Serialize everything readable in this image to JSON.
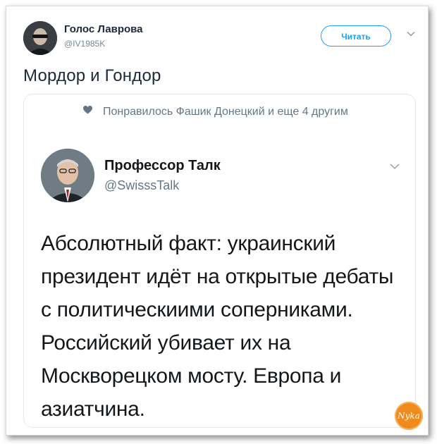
{
  "tweet": {
    "author": {
      "name": "Голос Лаврова",
      "handle": "@IV1985K"
    },
    "follow_label": "Читать",
    "text": "Мордор и Гондор"
  },
  "quoted": {
    "liked_text": "Понравилось Фашик Донецкий и еще 4 другим",
    "author": {
      "name": "Профессор Талк",
      "handle": "@SwisssTalk"
    },
    "body": "Абсолютный факт: украинский президент идёт на открытые дебаты с политическиими соперниками. Российский убивает их на Москворецком мосту. Европа и азиатчина."
  },
  "watermark": "Nyka",
  "colors": {
    "accent": "#1da1f2",
    "text": "#14171a",
    "muted": "#657786",
    "watermark": "#f08a1c"
  },
  "icons": {
    "like": "heart-icon",
    "menu": "chevron-down-icon"
  }
}
